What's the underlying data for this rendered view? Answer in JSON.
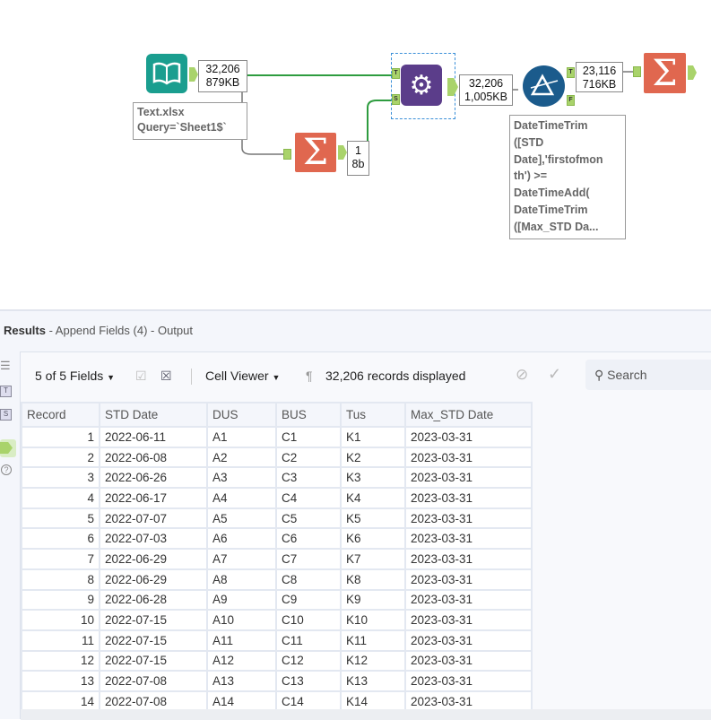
{
  "workflow": {
    "input": {
      "count": "32,206",
      "size": "879KB",
      "annotation_line1": "Text.xlsx",
      "annotation_line2": "Query=`Sheet1$`"
    },
    "summarize1": {
      "count": "1",
      "size": "8b"
    },
    "append": {
      "anchor_t": "T",
      "anchor_s": "S",
      "count": "32,206",
      "size": "1,005KB"
    },
    "filter": {
      "anchor_t": "T",
      "anchor_f": "F",
      "count": "23,116",
      "size": "716KB",
      "annotation": [
        "DateTimeTrim",
        "([STD",
        "Date],'firstofmon",
        "th') >=",
        "DateTimeAdd(",
        "DateTimeTrim",
        "([Max_STD Da..."
      ]
    }
  },
  "results": {
    "title": "Results",
    "subtitle": " - Append Fields (4) - Output",
    "fields_label": "5 of 5 Fields",
    "cell_viewer_label": "Cell Viewer",
    "records_label": "32,206 records displayed",
    "search_placeholder": "Search",
    "columns": [
      "Record",
      "STD Date",
      "DUS",
      "BUS",
      "Tus",
      "Max_STD Date"
    ],
    "rows": [
      [
        "1",
        "2022-06-11",
        "A1",
        "C1",
        "K1",
        "2023-03-31"
      ],
      [
        "2",
        "2022-06-08",
        "A2",
        "C2",
        "K2",
        "2023-03-31"
      ],
      [
        "3",
        "2022-06-26",
        "A3",
        "C3",
        "K3",
        "2023-03-31"
      ],
      [
        "4",
        "2022-06-17",
        "A4",
        "C4",
        "K4",
        "2023-03-31"
      ],
      [
        "5",
        "2022-07-07",
        "A5",
        "C5",
        "K5",
        "2023-03-31"
      ],
      [
        "6",
        "2022-07-03",
        "A6",
        "C6",
        "K6",
        "2023-03-31"
      ],
      [
        "7",
        "2022-06-29",
        "A7",
        "C7",
        "K7",
        "2023-03-31"
      ],
      [
        "8",
        "2022-06-29",
        "A8",
        "C8",
        "K8",
        "2023-03-31"
      ],
      [
        "9",
        "2022-06-28",
        "A9",
        "C9",
        "K9",
        "2023-03-31"
      ],
      [
        "10",
        "2022-07-15",
        "A10",
        "C10",
        "K10",
        "2023-03-31"
      ],
      [
        "11",
        "2022-07-15",
        "A11",
        "C11",
        "K11",
        "2023-03-31"
      ],
      [
        "12",
        "2022-07-15",
        "A12",
        "C12",
        "K12",
        "2023-03-31"
      ],
      [
        "13",
        "2022-07-08",
        "A13",
        "C13",
        "K13",
        "2023-03-31"
      ],
      [
        "14",
        "2022-07-08",
        "A14",
        "C14",
        "K14",
        "2023-03-31"
      ]
    ]
  },
  "colors": {
    "input": "#1a9e8f",
    "summarize": "#e0674f",
    "append": "#5b3d8a",
    "filter": "#1b5b8c",
    "connection": "#2e9c3f"
  }
}
